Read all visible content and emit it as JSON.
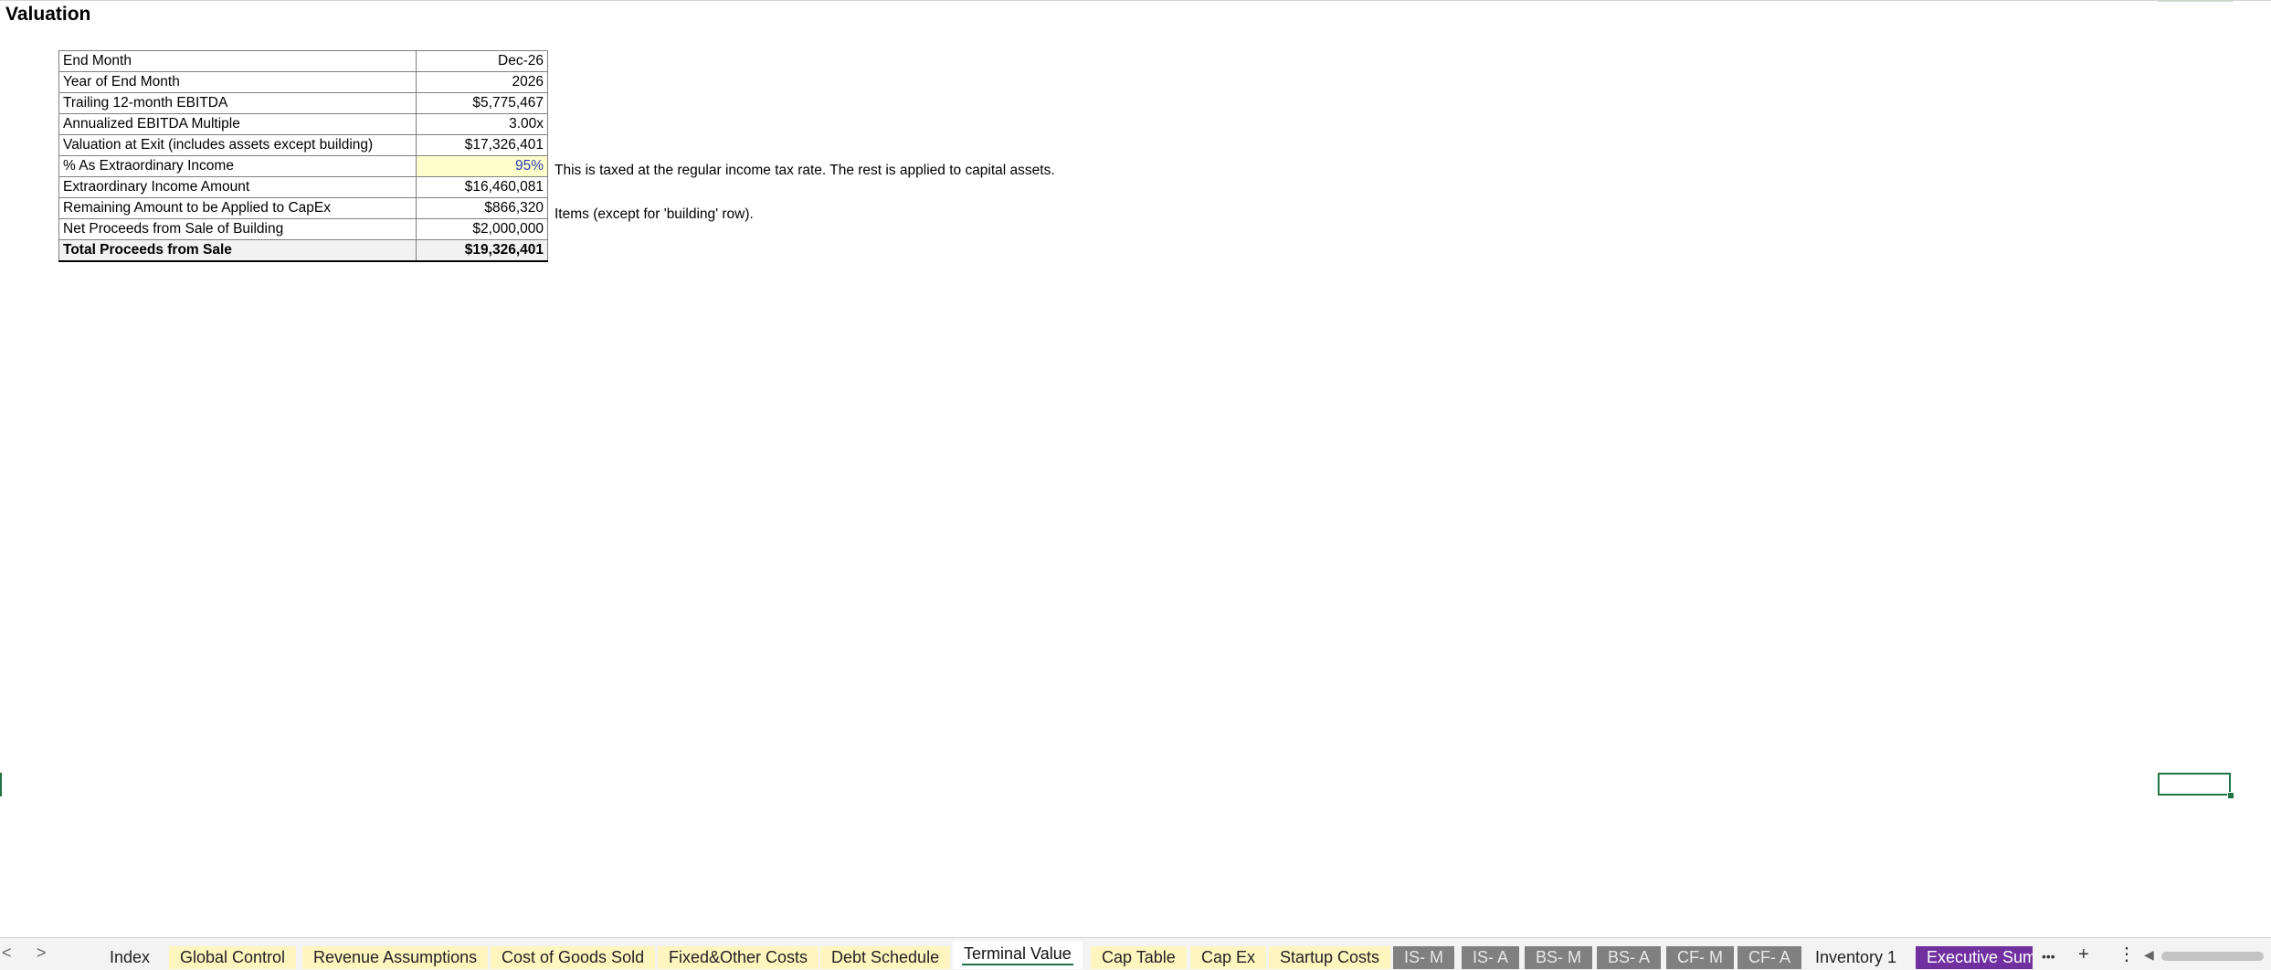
{
  "sheet": {
    "title": "Valuation",
    "rows": [
      {
        "label": "End Month",
        "value": "Dec-26"
      },
      {
        "label": "Year of End Month",
        "value": "2026"
      },
      {
        "label": "Trailing 12-month EBITDA",
        "value": "$5,775,467"
      },
      {
        "label": "Annualized EBITDA Multiple",
        "value": "3.00x"
      },
      {
        "label": "Valuation at Exit (includes assets except building)",
        "value": "$17,326,401"
      },
      {
        "label": "% As Extraordinary Income",
        "value": "95%"
      },
      {
        "label": "Extraordinary Income Amount",
        "value": "$16,460,081"
      },
      {
        "label": "Remaining Amount to be Applied to CapEx",
        "value": "$866,320"
      },
      {
        "label": "Net Proceeds from Sale of Building",
        "value": "$2,000,000"
      },
      {
        "label": "Total Proceeds from Sale",
        "value": "$19,326,401"
      }
    ],
    "notes": {
      "extraordinary": "This is taxed at the regular income tax rate. The rest is applied to capital assets.",
      "capex": "Items (except for 'building' row)."
    },
    "input_cell_color": "#ffffcc",
    "input_text_color": "#2b3bb0"
  },
  "tabs": {
    "prev": "<",
    "next": ">",
    "items": [
      {
        "label": "Index",
        "style": "plain"
      },
      {
        "label": "Global Control",
        "style": "yellow"
      },
      {
        "label": "Revenue Assumptions",
        "style": "yellow"
      },
      {
        "label": "Cost of Goods Sold",
        "style": "yellow"
      },
      {
        "label": "Fixed&Other Costs",
        "style": "yellow"
      },
      {
        "label": "Debt Schedule",
        "style": "yellow"
      },
      {
        "label": "Terminal Value",
        "style": "active"
      },
      {
        "label": "Cap Table",
        "style": "yellow"
      },
      {
        "label": "Cap Ex",
        "style": "yellow"
      },
      {
        "label": "Startup Costs",
        "style": "yellow"
      },
      {
        "label": "IS- M",
        "style": "gray"
      },
      {
        "label": "IS- A",
        "style": "gray"
      },
      {
        "label": "BS- M",
        "style": "gray"
      },
      {
        "label": "BS- A",
        "style": "gray"
      },
      {
        "label": "CF- M",
        "style": "gray"
      },
      {
        "label": "CF- A",
        "style": "gray"
      },
      {
        "label": "Inventory 1",
        "style": "plain"
      },
      {
        "label": "Executive Sumr",
        "style": "purple"
      }
    ],
    "more": "•••",
    "add": "+",
    "options": "⋮",
    "tab_colors": {
      "yellow": "#fff6bf",
      "gray": "#808080",
      "purple": "#7030a0",
      "active_underline": "#217346"
    }
  }
}
